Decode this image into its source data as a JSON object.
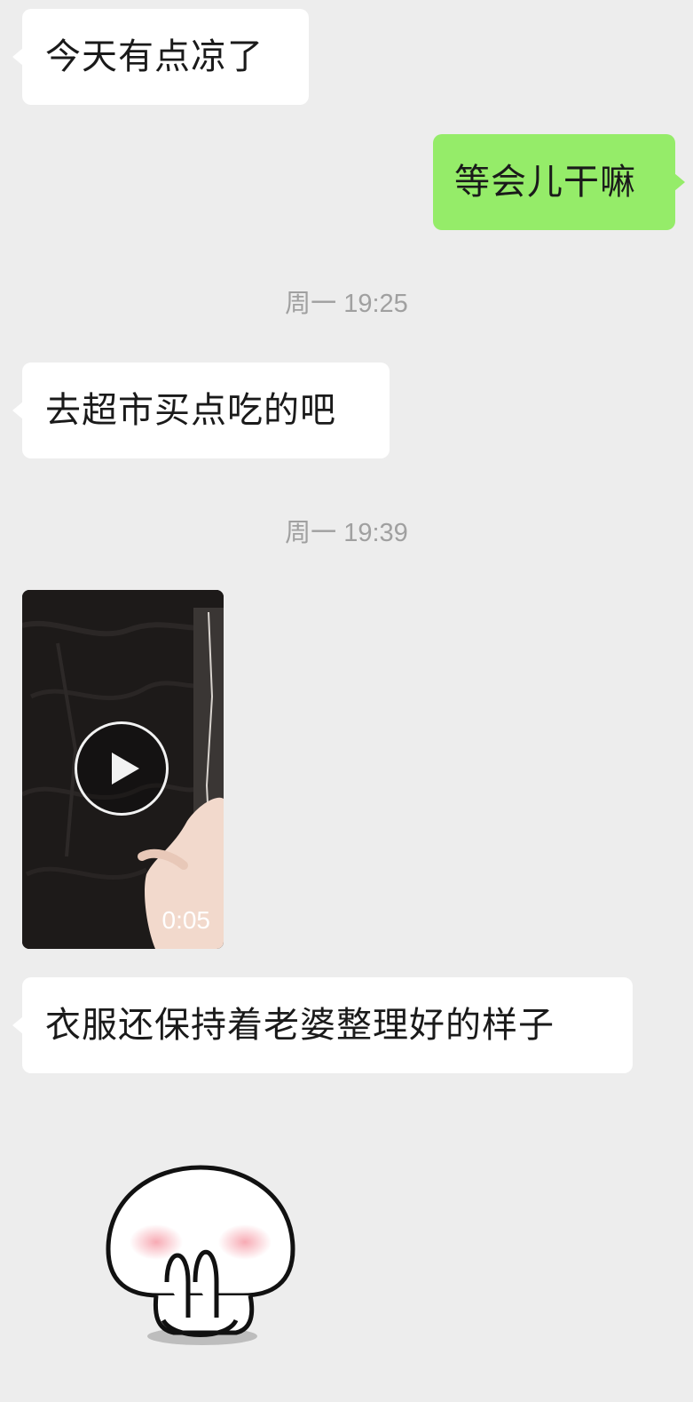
{
  "messages": {
    "m1": "今天有点凉了",
    "m2": "等会儿干嘛",
    "m3": "去超市买点吃的吧",
    "m4": "衣服还保持着老婆整理好的样子"
  },
  "timestamps": {
    "t1": "周一 19:25",
    "t2": "周一 19:39"
  },
  "video": {
    "duration": "0:05",
    "play_icon": "play-icon"
  },
  "sticker": {
    "icon": "blushing-mushroom-sticker"
  },
  "colors": {
    "background": "#ededed",
    "incoming_bubble": "#ffffff",
    "outgoing_bubble": "#95ec69",
    "timestamp_text": "#a0a0a0"
  }
}
